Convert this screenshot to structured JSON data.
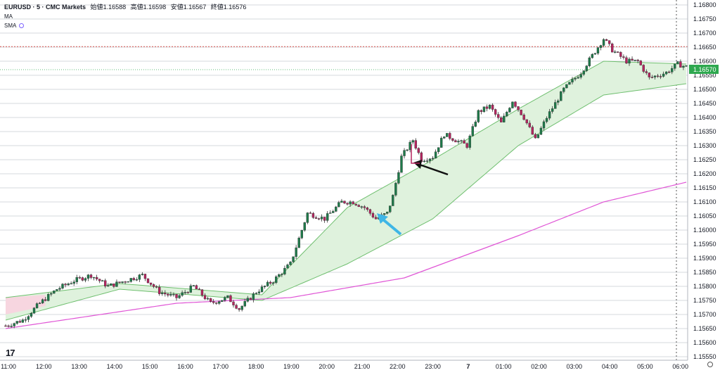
{
  "legend": {
    "symbol": "EURUSD · 5 · CMC Markets",
    "open_label": "始値",
    "open": "1.16588",
    "high_label": "高値",
    "high": "1.16598",
    "low_label": "安値",
    "low": "1.16567",
    "close_label": "終値",
    "close": "1.16576",
    "ma_label": "MA",
    "sma_label": "SMA"
  },
  "colors": {
    "up": "#1e7a4a",
    "down": "#b5245f",
    "band_fill": "#dff2dd",
    "band_line": "#6fbf6f",
    "magenta_line": "#e056d6",
    "price_badge": "#2ea84f",
    "arrow_blue": "#3fb6e6",
    "arrow_black": "#111111"
  },
  "chart_data": {
    "type": "candlestick",
    "ylim": [
      1.1555,
      1.168
    ],
    "y_ticks": [
      "1.16800",
      "1.16750",
      "1.16700",
      "1.16650",
      "1.16600",
      "1.16550",
      "1.16500",
      "1.16450",
      "1.16400",
      "1.16350",
      "1.16300",
      "1.16250",
      "1.16200",
      "1.16150",
      "1.16100",
      "1.16050",
      "1.16000",
      "1.15950",
      "1.15900",
      "1.15850",
      "1.15800",
      "1.15750",
      "1.15700",
      "1.15650",
      "1.15600",
      "1.15550"
    ],
    "x_ticks": [
      "11:00",
      "12:00",
      "13:00",
      "14:00",
      "15:00",
      "16:00",
      "17:00",
      "18:00",
      "19:00",
      "20:00",
      "21:00",
      "22:00",
      "23:00",
      "7",
      "01:00",
      "02:00",
      "03:00",
      "04:00",
      "05:00",
      "06:00"
    ],
    "current_price": "1.16570",
    "current_price_value": 1.1657,
    "level_line": 1.16652,
    "candle_count": 240,
    "key_closes": [
      [
        0,
        1.1566
      ],
      [
        6,
        1.1568
      ],
      [
        12,
        1.1574
      ],
      [
        18,
        1.1579
      ],
      [
        24,
        1.1582
      ],
      [
        30,
        1.1584
      ],
      [
        36,
        1.158
      ],
      [
        42,
        1.1582
      ],
      [
        48,
        1.1584
      ],
      [
        54,
        1.1578
      ],
      [
        60,
        1.1576
      ],
      [
        66,
        1.158
      ],
      [
        72,
        1.1574
      ],
      [
        78,
        1.1576
      ],
      [
        82,
        1.1572
      ],
      [
        88,
        1.1578
      ],
      [
        94,
        1.1582
      ],
      [
        100,
        1.1588
      ],
      [
        104,
        1.16
      ],
      [
        106,
        1.1606
      ],
      [
        112,
        1.1604
      ],
      [
        118,
        1.161
      ],
      [
        122,
        1.161
      ],
      [
        126,
        1.1608
      ],
      [
        130,
        1.1604
      ],
      [
        134,
        1.1606
      ],
      [
        136,
        1.1612
      ],
      [
        139,
        1.1626
      ],
      [
        143,
        1.1632
      ],
      [
        146,
        1.1625
      ],
      [
        150,
        1.1626
      ],
      [
        154,
        1.1634
      ],
      [
        158,
        1.1632
      ],
      [
        162,
        1.163
      ],
      [
        166,
        1.1642
      ],
      [
        170,
        1.1644
      ],
      [
        174,
        1.1638
      ],
      [
        178,
        1.1646
      ],
      [
        182,
        1.164
      ],
      [
        186,
        1.1632
      ],
      [
        190,
        1.164
      ],
      [
        196,
        1.165
      ],
      [
        202,
        1.1656
      ],
      [
        206,
        1.1662
      ],
      [
        210,
        1.1668
      ],
      [
        213,
        1.1664
      ],
      [
        218,
        1.166
      ],
      [
        222,
        1.166
      ],
      [
        226,
        1.1654
      ],
      [
        232,
        1.1656
      ],
      [
        236,
        1.1659
      ],
      [
        239,
        1.1658
      ]
    ],
    "band_upper": [
      [
        0,
        1.1576
      ],
      [
        40,
        1.1581
      ],
      [
        90,
        1.1577
      ],
      [
        120,
        1.1608
      ],
      [
        150,
        1.1625
      ],
      [
        180,
        1.1643
      ],
      [
        210,
        1.166
      ],
      [
        239,
        1.1659
      ]
    ],
    "band_lower": [
      [
        0,
        1.1568
      ],
      [
        40,
        1.1579
      ],
      [
        90,
        1.1575
      ],
      [
        120,
        1.1588
      ],
      [
        150,
        1.1604
      ],
      [
        180,
        1.163
      ],
      [
        210,
        1.1648
      ],
      [
        239,
        1.1652
      ]
    ],
    "magenta_series": [
      [
        0,
        1.1565
      ],
      [
        60,
        1.1574
      ],
      [
        100,
        1.1576
      ],
      [
        140,
        1.1583
      ],
      [
        180,
        1.1598
      ],
      [
        210,
        1.161
      ],
      [
        239,
        1.1617
      ]
    ]
  }
}
